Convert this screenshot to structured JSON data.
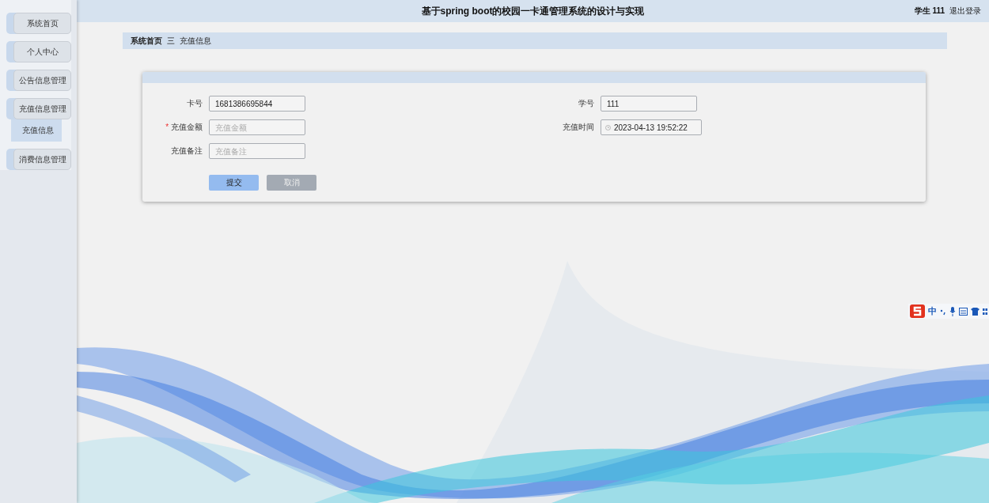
{
  "header": {
    "title": "基于spring boot的校园一卡通管理系统的设计与实现",
    "user": "学生 111",
    "logout": "退出登录"
  },
  "sidebar": {
    "items": [
      {
        "label": "系统首页"
      },
      {
        "label": "个人中心"
      },
      {
        "label": "公告信息管理"
      },
      {
        "label": "充值信息管理",
        "children": [
          {
            "label": "充值信息",
            "selected": true
          }
        ]
      },
      {
        "label": "消费信息管理"
      }
    ]
  },
  "breadcrumb": {
    "items": [
      "系统首页",
      "充值信息"
    ],
    "separator": "三"
  },
  "form": {
    "left": [
      {
        "kind": "text",
        "label": "卡号",
        "value": "1681386695844"
      },
      {
        "kind": "text",
        "label": "充值金额",
        "required_mark": "*",
        "placeholder": "充值金额"
      },
      {
        "kind": "text",
        "label": "充值备注",
        "placeholder": "充值备注"
      }
    ],
    "right": [
      {
        "kind": "text",
        "label": "学号",
        "value": "111"
      },
      {
        "kind": "datetime",
        "label": "充值时间",
        "value": "2023-04-13 19:52:22"
      }
    ],
    "buttons": [
      {
        "label": "提交",
        "kind": "primary"
      },
      {
        "label": "取消",
        "kind": "secondary"
      }
    ]
  },
  "ime_toolbar": {
    "mode": "中"
  }
}
